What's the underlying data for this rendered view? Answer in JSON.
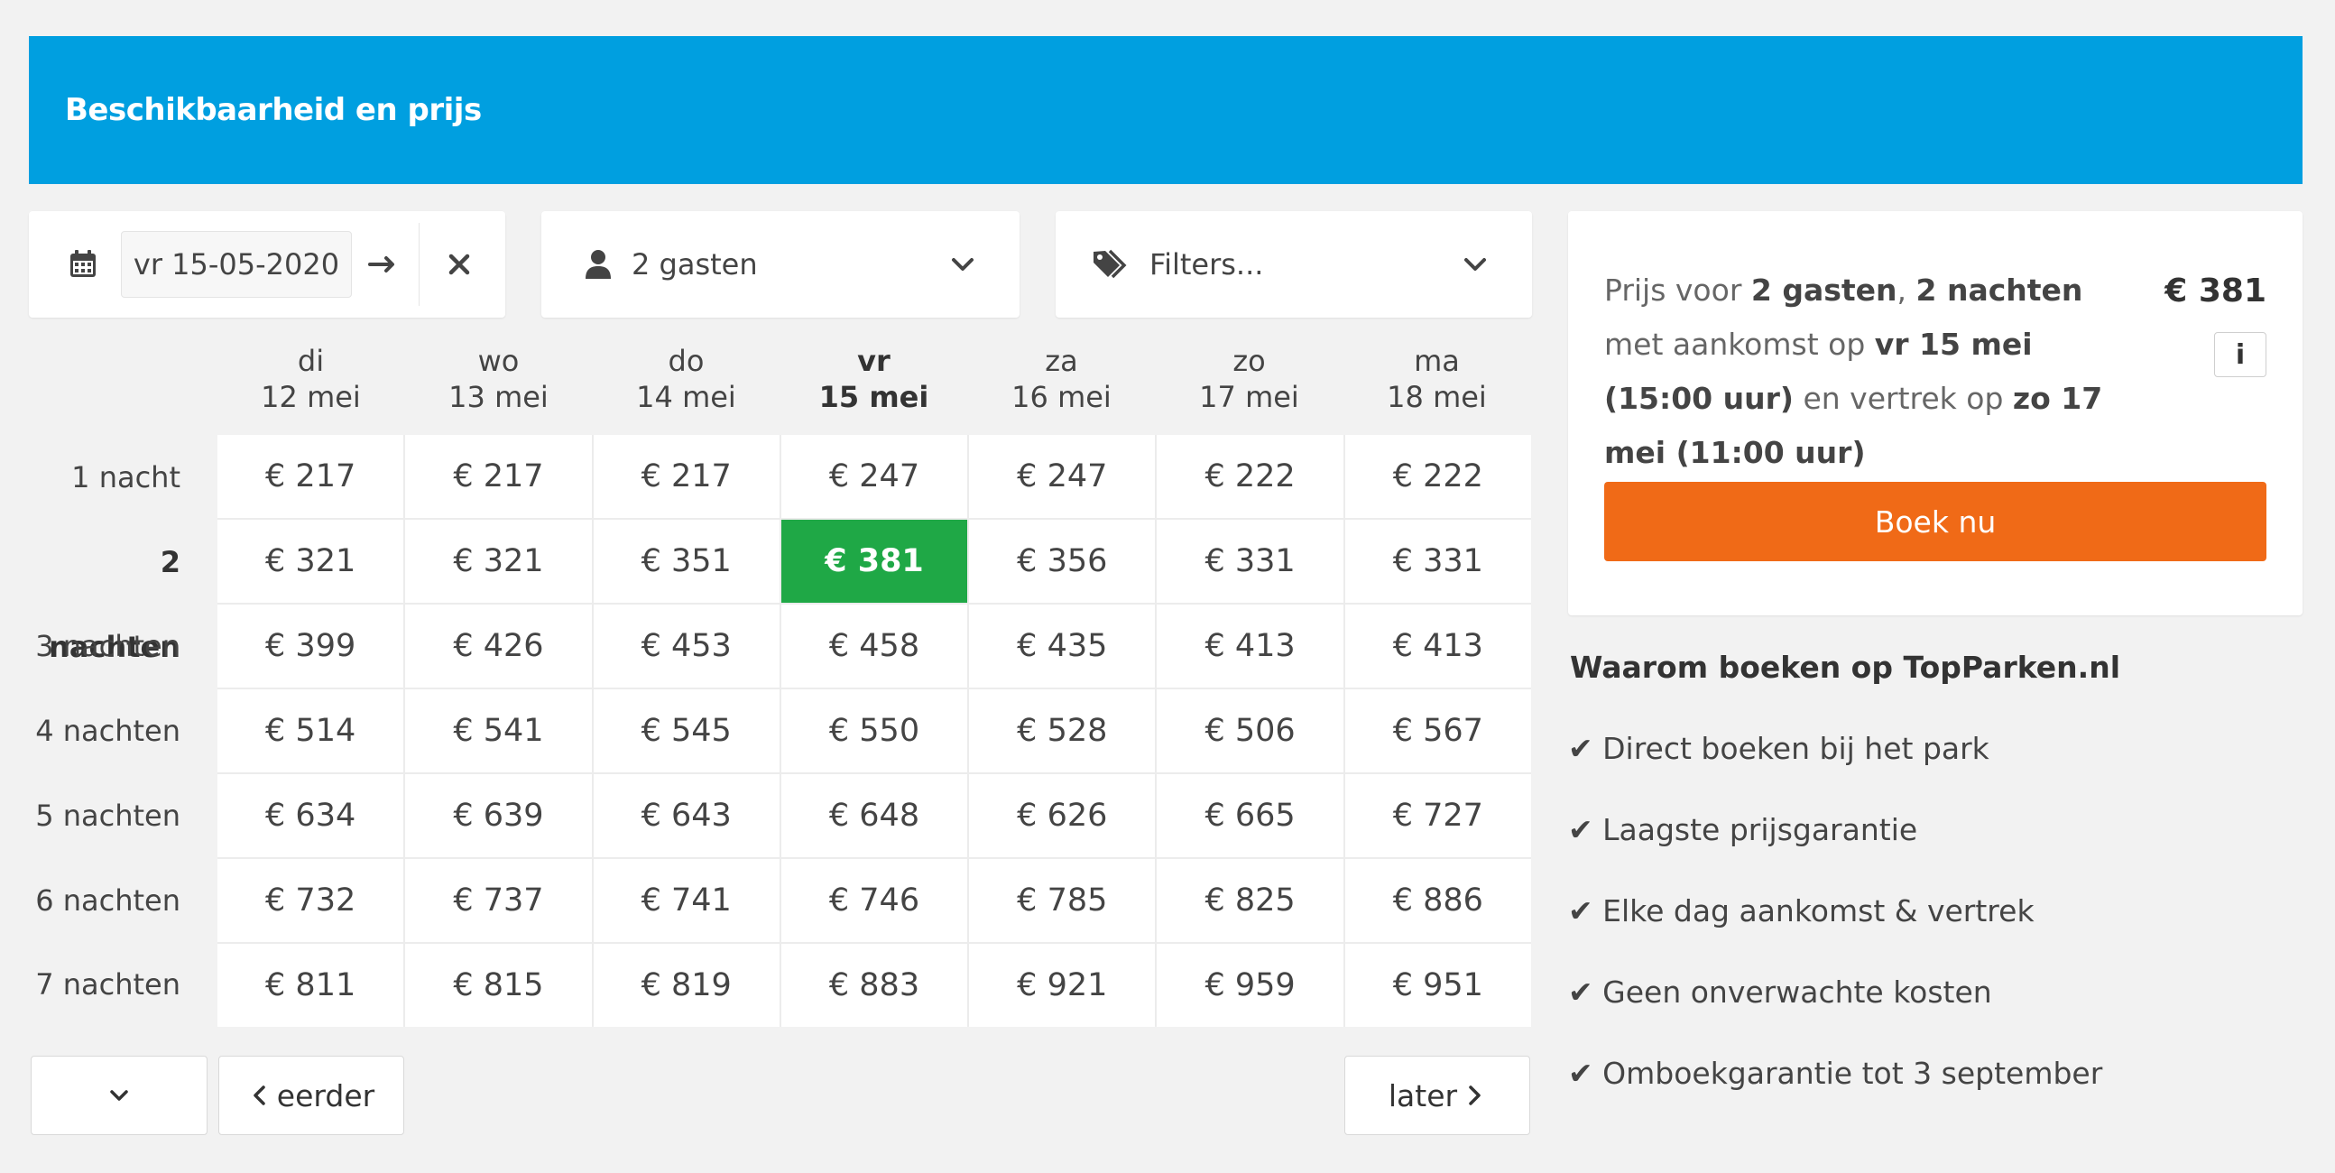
{
  "header": {
    "title": "Beschikbaarheid en prijs"
  },
  "date_picker": {
    "value": "vr 15-05-2020",
    "calendar_icon": "calendar-icon",
    "arrow_icon": "arrow-right-icon",
    "clear_icon": "close-icon"
  },
  "guests": {
    "label": "2 gasten",
    "icon": "user-icon"
  },
  "filters": {
    "label": "Filters...",
    "icon": "tags-icon"
  },
  "columns": [
    {
      "day": "di",
      "date": "12 mei"
    },
    {
      "day": "wo",
      "date": "13 mei"
    },
    {
      "day": "do",
      "date": "14 mei"
    },
    {
      "day": "vr",
      "date": "15 mei",
      "selected": true
    },
    {
      "day": "za",
      "date": "16 mei"
    },
    {
      "day": "zo",
      "date": "17 mei"
    },
    {
      "day": "ma",
      "date": "18 mei"
    }
  ],
  "rows": [
    {
      "label": "1 nacht",
      "prices": [
        "€ 217",
        "€ 217",
        "€ 217",
        "€ 247",
        "€ 247",
        "€ 222",
        "€ 222"
      ]
    },
    {
      "label": "2 nachten",
      "selected": true,
      "prices": [
        "€ 321",
        "€ 321",
        "€ 351",
        "€ 381",
        "€ 356",
        "€ 331",
        "€ 331"
      ]
    },
    {
      "label": "3 nachten",
      "prices": [
        "€ 399",
        "€ 426",
        "€ 453",
        "€ 458",
        "€ 435",
        "€ 413",
        "€ 413"
      ]
    },
    {
      "label": "4 nachten",
      "prices": [
        "€ 514",
        "€ 541",
        "€ 545",
        "€ 550",
        "€ 528",
        "€ 506",
        "€ 567"
      ]
    },
    {
      "label": "5 nachten",
      "prices": [
        "€ 634",
        "€ 639",
        "€ 643",
        "€ 648",
        "€ 626",
        "€ 665",
        "€ 727"
      ]
    },
    {
      "label": "6 nachten",
      "prices": [
        "€ 732",
        "€ 737",
        "€ 741",
        "€ 746",
        "€ 785",
        "€ 825",
        "€ 886"
      ]
    },
    {
      "label": "7 nachten",
      "prices": [
        "€ 811",
        "€ 815",
        "€ 819",
        "€ 883",
        "€ 921",
        "€ 959",
        "€ 951"
      ]
    }
  ],
  "selected_cell": {
    "row": 1,
    "col": 3
  },
  "nav": {
    "earlier_label": "eerder",
    "later_label": "later"
  },
  "summary": {
    "t1": "Prijs voor ",
    "guests": "2 gasten",
    "t2": ", ",
    "nights": "2 nachten",
    "t3": " met aankomst op ",
    "arrival": "vr 15 mei (15:00 uur)",
    "t4": " en vertrek op ",
    "departure": "zo 17 mei (11:00 uur)",
    "price": "€ 381",
    "info_label": "i",
    "book_label": "Boek nu"
  },
  "why": {
    "title": "Waarom boeken op TopParken.nl",
    "items": [
      "✔ Direct boeken bij het park",
      "✔ Laagste prijsgarantie",
      "✔ Elke dag aankomst & vertrek",
      "✔ Geen onverwachte kosten",
      "✔ Omboekgarantie tot 3 september"
    ]
  },
  "colors": {
    "header": "#009fe0",
    "selected": "#1fa846",
    "book": "#f06a17"
  }
}
